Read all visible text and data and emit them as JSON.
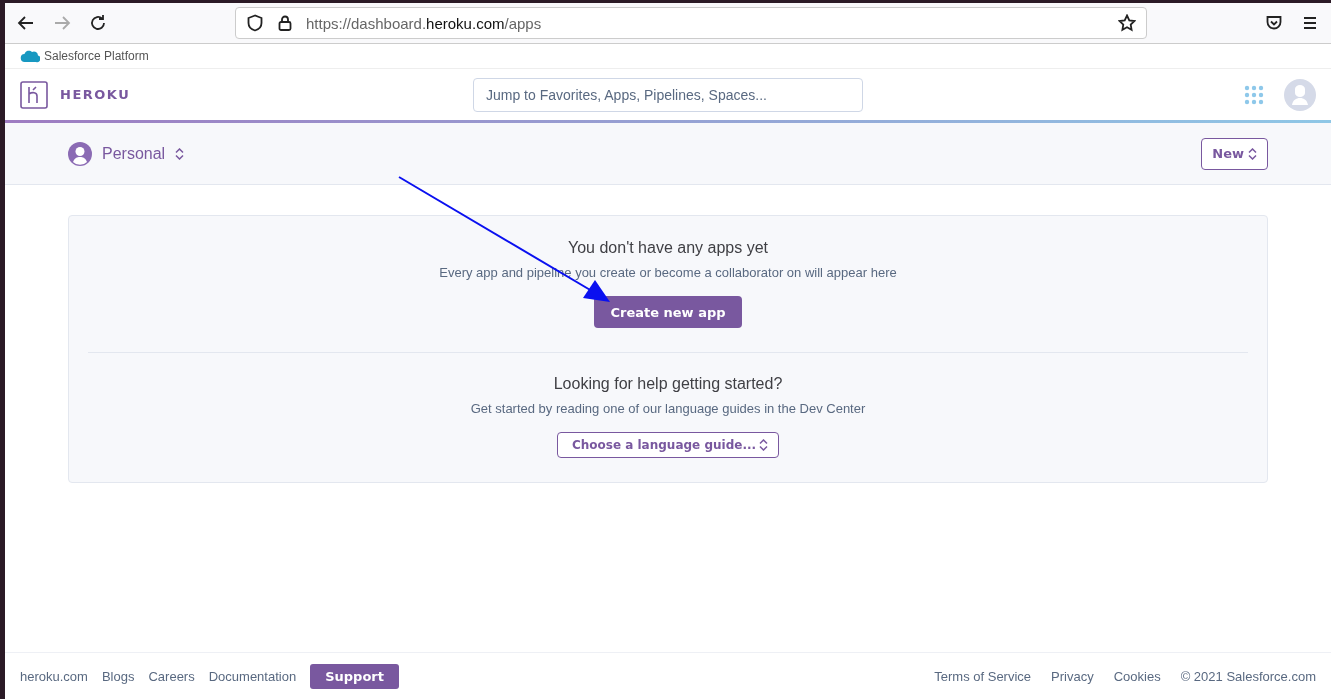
{
  "browser": {
    "url_prefix": "https://dashboard.",
    "url_domain": "heroku.com",
    "url_suffix": "/apps",
    "forward_disabled": true
  },
  "platform_bar": {
    "label": "Salesforce Platform"
  },
  "header": {
    "brand": "HEROKU",
    "search": {
      "placeholder": "Jump to Favorites, Apps, Pipelines, Spaces..."
    }
  },
  "subheader": {
    "account": "Personal",
    "new_button": "New"
  },
  "empty_state": {
    "title": "You don't have any apps yet",
    "text": "Every app and pipeline you create or become a collaborator on will appear here",
    "button": "Create new app"
  },
  "help": {
    "title": "Looking for help getting started?",
    "text": "Get started by reading one of our language guides in the Dev Center",
    "select": "Choose a language guide..."
  },
  "footer": {
    "links": [
      "heroku.com",
      "Blogs",
      "Careers",
      "Documentation"
    ],
    "support": "Support",
    "right_links": [
      "Terms of Service",
      "Privacy",
      "Cookies"
    ],
    "copyright": "© 2021 Salesforce.com"
  }
}
